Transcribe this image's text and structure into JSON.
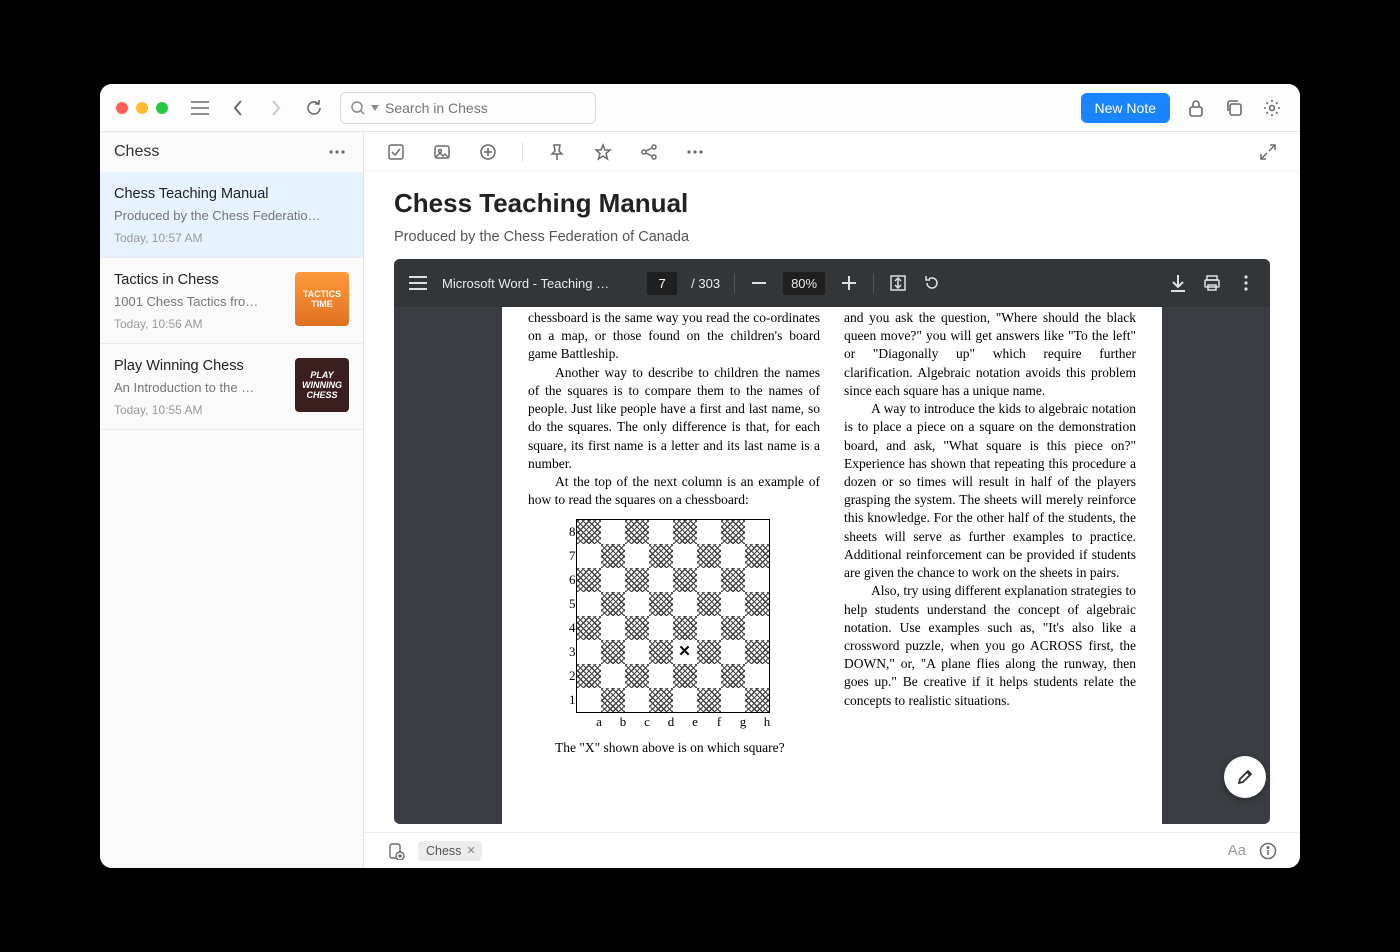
{
  "toolbar": {
    "search_placeholder": "Search in Chess",
    "new_note_label": "New Note"
  },
  "sidebar": {
    "title": "Chess",
    "notes": [
      {
        "title": "Chess Teaching Manual",
        "subtitle": "Produced by the Chess Federatio…",
        "time": "Today, 10:57 AM"
      },
      {
        "title": "Tactics in Chess",
        "subtitle": "1001 Chess Tactics fro…",
        "time": "Today, 10:56 AM",
        "thumb_text": "TACTICS\nTIME"
      },
      {
        "title": "Play Winning Chess",
        "subtitle": "An Introduction to the …",
        "time": "Today, 10:55 AM",
        "thumb_text": "PLAY\nWINNING\nCHESS"
      }
    ]
  },
  "document": {
    "title": "Chess Teaching Manual",
    "subtitle": "Produced by the Chess Federation of Canada"
  },
  "pdf": {
    "doc_title": "Microsoft Word - Teaching …",
    "page_current": "7",
    "page_total": "/ 303",
    "zoom": "80%",
    "col1_p1": "chessboard is the same way you read the co-ordinates on a map, or those found on the children's board game Battleship.",
    "col1_p2": "Another way to describe to children the names of the squares is to compare them to the names of people. Just like people have a first and last name, so do the squares. The only difference is that, for each square, its first name is a letter and its last name is a number.",
    "col1_p3": "At the top of the next column is an example of how to read the squares on a chessboard:",
    "col1_p4": "The \"X\" shown above is on which square?",
    "col2_p1": "and you ask the question, \"Where should the black queen move?\" you will get answers like \"To the left\" or \"Diagonally up\" which require further clarification. Algebraic notation avoids this problem since each square has a unique name.",
    "col2_p2": "A way to introduce the kids to algebraic notation is to place a piece on a square on the demonstration board, and ask, \"What square is this piece on?\" Experience has shown that repeating this procedure a dozen or so times will result in half of the players grasping the system. The sheets will merely reinforce this knowledge. For the other half of the students, the sheets will serve as further examples to practice. Additional reinforcement can be provided if students are given the chance to work on the sheets in pairs.",
    "col2_p3": "Also, try using different explanation strategies to help students understand the concept of algebraic notation. Use examples such as, \"It's also like a crossword puzzle, when you go ACROSS first, the DOWN,\" or, \"A plane flies along the runway, then goes up.\" Be creative if it helps students relate the concepts to realistic situations.",
    "ranks": [
      "8",
      "7",
      "6",
      "5",
      "4",
      "3",
      "2",
      "1"
    ],
    "files": [
      "a",
      "b",
      "c",
      "d",
      "e",
      "f",
      "g",
      "h"
    ]
  },
  "footer": {
    "tag": "Chess",
    "aa": "Aa"
  }
}
